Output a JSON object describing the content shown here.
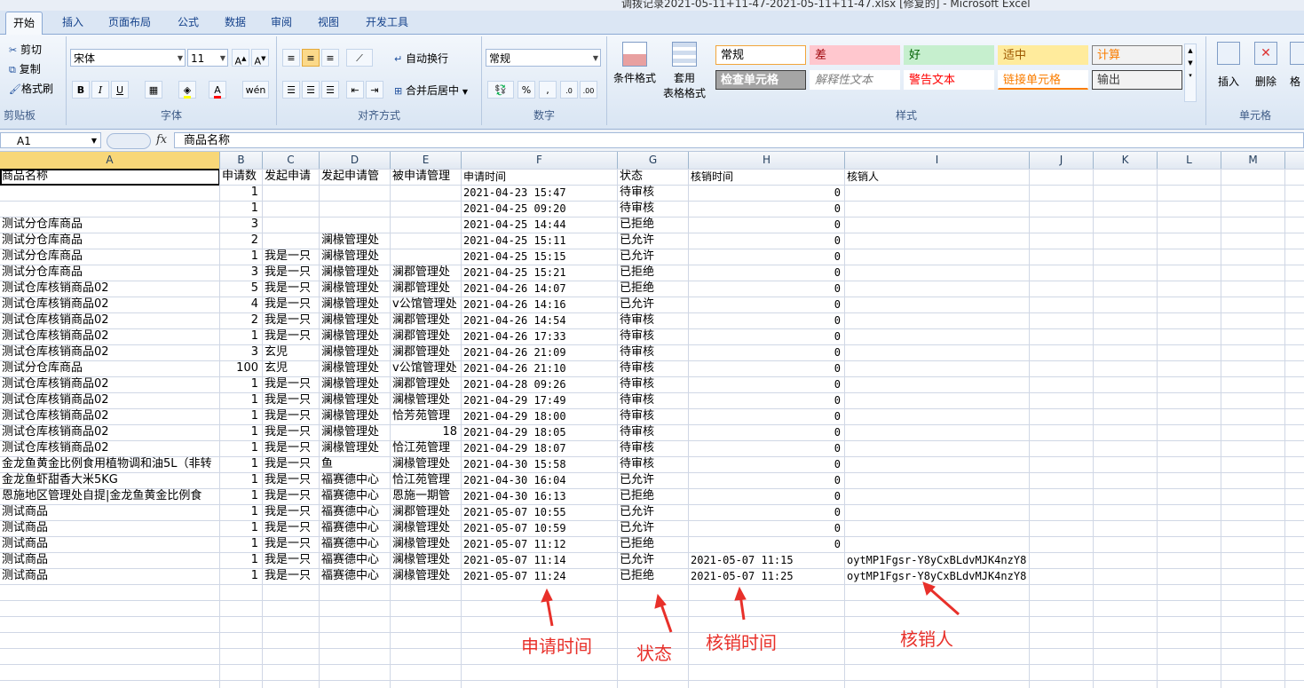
{
  "window_title": "调拨记录2021-05-11+11-47-2021-05-11+11-47.xlsx [修复的] - Microsoft Excel",
  "tabs": [
    "开始",
    "插入",
    "页面布局",
    "公式",
    "数据",
    "审阅",
    "视图",
    "开发工具"
  ],
  "ribbon": {
    "clipboard": {
      "label": "剪贴板",
      "cut": "剪切",
      "copy": "复制",
      "format_painter": "格式刷"
    },
    "font": {
      "label": "字体",
      "name": "宋体",
      "size": "11"
    },
    "alignment": {
      "label": "对齐方式",
      "wrap": "自动换行",
      "merge": "合并后居中"
    },
    "number": {
      "label": "数字",
      "format": "常规"
    },
    "styles": {
      "label": "样式",
      "conditional": "条件格式",
      "table_format_1": "套用",
      "table_format_2": "表格格式",
      "items": [
        {
          "text": "常规",
          "bg": "#ffffff",
          "fg": "#000000",
          "border": "#f2a53a"
        },
        {
          "text": "差",
          "bg": "#ffc7ce",
          "fg": "#9c0006",
          "border": "#ffc7ce"
        },
        {
          "text": "好",
          "bg": "#c6efce",
          "fg": "#006100",
          "border": "#c6efce"
        },
        {
          "text": "适中",
          "bg": "#ffeb9c",
          "fg": "#9c5700",
          "border": "#ffeb9c"
        },
        {
          "text": "计算",
          "bg": "#f2f2f2",
          "fg": "#fa7d00",
          "border": "#7f7f7f"
        },
        {
          "text": "检查单元格",
          "bg": "#a5a5a5",
          "fg": "#ffffff",
          "border": "#3f3f3f"
        },
        {
          "text": "解释性文本",
          "bg": "#ffffff",
          "fg": "#7f7f7f",
          "border": "#ffffff"
        },
        {
          "text": "警告文本",
          "bg": "#ffffff",
          "fg": "#ff0000",
          "border": "#ffffff"
        },
        {
          "text": "链接单元格",
          "bg": "#ffffff",
          "fg": "#fa7d00",
          "border": "#ffffff"
        },
        {
          "text": "输出",
          "bg": "#f2f2f2",
          "fg": "#3f3f3f",
          "border": "#3f3f3f"
        }
      ]
    },
    "cells": {
      "label": "单元格",
      "insert": "插入",
      "delete": "删除",
      "format": "格"
    }
  },
  "formula_bar": {
    "name_box": "A1",
    "fx": "fx",
    "content": "商品名称"
  },
  "columns": [
    "A",
    "B",
    "C",
    "D",
    "E",
    "F",
    "G",
    "H",
    "I",
    "J",
    "K",
    "L",
    "M"
  ],
  "header_row": [
    "商品名称",
    "申请数",
    "发起申请",
    "发起申请管",
    "被申请管理",
    "申请时间",
    "状态",
    "核销时间",
    "核销人"
  ],
  "rows": [
    [
      "",
      "1",
      "",
      "",
      "",
      "2021-04-23 15:47",
      "待审核",
      "0",
      ""
    ],
    [
      "",
      "1",
      "",
      "",
      "",
      "2021-04-25 09:20",
      "待审核",
      "0",
      ""
    ],
    [
      "测试分仓库商品",
      "3",
      "",
      "",
      "",
      "2021-04-25 14:44",
      "已拒绝",
      "0",
      ""
    ],
    [
      "测试分仓库商品",
      "2",
      "",
      "澜椽管理处",
      "",
      "2021-04-25 15:11",
      "已允许",
      "0",
      ""
    ],
    [
      "测试分仓库商品",
      "1",
      "我是一只",
      "澜椽管理处",
      "",
      "2021-04-25 15:15",
      "已允许",
      "0",
      ""
    ],
    [
      "测试分仓库商品",
      "3",
      "我是一只",
      "澜椽管理处",
      "澜郡管理处",
      "2021-04-25 15:21",
      "已拒绝",
      "0",
      ""
    ],
    [
      "测试仓库核销商品02",
      "5",
      "我是一只",
      "澜椽管理处",
      "澜郡管理处",
      "2021-04-26 14:07",
      "已拒绝",
      "0",
      ""
    ],
    [
      "测试仓库核销商品02",
      "4",
      "我是一只",
      "澜椽管理处",
      "v公馆管理处",
      "2021-04-26 14:16",
      "已允许",
      "0",
      ""
    ],
    [
      "测试仓库核销商品02",
      "2",
      "我是一只",
      "澜椽管理处",
      "澜郡管理处",
      "2021-04-26 14:54",
      "待审核",
      "0",
      ""
    ],
    [
      "测试仓库核销商品02",
      "1",
      "我是一只",
      "澜椽管理处",
      "澜郡管理处",
      "2021-04-26 17:33",
      "待审核",
      "0",
      ""
    ],
    [
      "测试仓库核销商品02",
      "3",
      "玄児",
      "澜椽管理处",
      "澜郡管理处",
      "2021-04-26 21:09",
      "待审核",
      "0",
      ""
    ],
    [
      "测试分仓库商品",
      "100",
      "玄児",
      "澜椽管理处",
      "v公馆管理处",
      "2021-04-26 21:10",
      "待审核",
      "0",
      ""
    ],
    [
      "测试仓库核销商品02",
      "1",
      "我是一只",
      "澜椽管理处",
      "澜郡管理处",
      "2021-04-28 09:26",
      "待审核",
      "0",
      ""
    ],
    [
      "测试仓库核销商品02",
      "1",
      "我是一只",
      "澜椽管理处",
      "澜椽管理处",
      "2021-04-29 17:49",
      "待审核",
      "0",
      ""
    ],
    [
      "测试仓库核销商品02",
      "1",
      "我是一只",
      "澜椽管理处",
      "恰芳苑管理",
      "2021-04-29 18:00",
      "待审核",
      "0",
      ""
    ],
    [
      "测试仓库核销商品02",
      "1",
      "我是一只",
      "澜椽管理处",
      "18",
      "2021-04-29 18:05",
      "待审核",
      "0",
      ""
    ],
    [
      "测试仓库核销商品02",
      "1",
      "我是一只",
      "澜椽管理处",
      "恰江苑管理",
      "2021-04-29 18:07",
      "待审核",
      "0",
      ""
    ],
    [
      "金龙鱼黄金比例食用植物调和油5L（非转",
      "1",
      "我是一只",
      "鱼",
      "澜椽管理处",
      "2021-04-30 15:58",
      "待审核",
      "0",
      ""
    ],
    [
      "金龙鱼虾甜香大米5KG",
      "1",
      "我是一只",
      "福赛德中心",
      "恰江苑管理",
      "2021-04-30 16:04",
      "已允许",
      "0",
      ""
    ],
    [
      "恩施地区管理处自提|金龙鱼黄金比例食",
      "1",
      "我是一只",
      "福赛德中心",
      "恩施一期管",
      "2021-04-30 16:13",
      "已拒绝",
      "0",
      ""
    ],
    [
      "测试商品",
      "1",
      "我是一只",
      "福赛德中心",
      "澜郡管理处",
      "2021-05-07 10:55",
      "已允许",
      "0",
      ""
    ],
    [
      "测试商品",
      "1",
      "我是一只",
      "福赛德中心",
      "澜椽管理处",
      "2021-05-07 10:59",
      "已允许",
      "0",
      ""
    ],
    [
      "测试商品",
      "1",
      "我是一只",
      "福赛德中心",
      "澜椽管理处",
      "2021-05-07 11:12",
      "已拒绝",
      "0",
      ""
    ],
    [
      "测试商品",
      "1",
      "我是一只",
      "福赛德中心",
      "澜椽管理处",
      "2021-05-07 11:14",
      "已允许",
      "2021-05-07 11:15",
      "oytMP1Fgsr-Y8yCxBLdvMJK4nzY8"
    ],
    [
      "测试商品",
      "1",
      "我是一只",
      "福赛德中心",
      "澜椽管理处",
      "2021-05-07 11:24",
      "已拒绝",
      "2021-05-07 11:25",
      "oytMP1Fgsr-Y8yCxBLdvMJK4nzY8"
    ]
  ],
  "annotations": {
    "apply_time": "申请时间",
    "status": "状态",
    "verify_time": "核销时间",
    "verifier": "核销人",
    "color": "#e8302a"
  }
}
